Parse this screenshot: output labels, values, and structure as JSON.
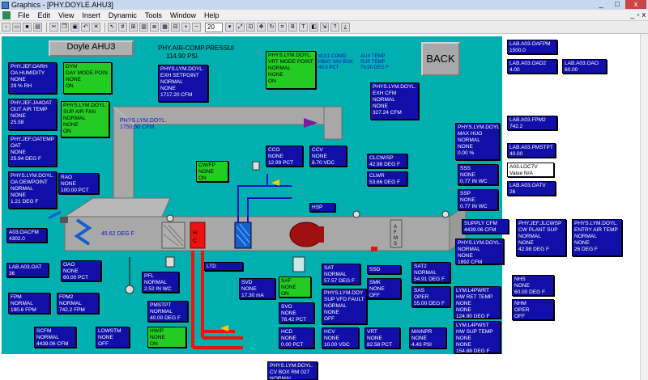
{
  "window": {
    "title": "Graphics - [PHY.DOYLE.AHU3]",
    "min": "_",
    "max": "□",
    "close": "x"
  },
  "menu": [
    "File",
    "Edit",
    "View",
    "Insert",
    "Dynamic",
    "Tools",
    "Window",
    "Help"
  ],
  "mdi": {
    "min": "_",
    "restore": "▫",
    "close": "x"
  },
  "toolbar": {
    "zoom": "20"
  },
  "header": {
    "ahu_title": "Doyle AHU3",
    "back_label": "BACK",
    "air_comp_label": "PHY.AIR-COMP.PRESSUI",
    "air_comp_value": "114.90 PSI"
  },
  "labels": {
    "vlv_comd": "VLV1 COMD\nHBAY VAV BOX\n40.0 PCT",
    "aux_temp": "AUX TEMP\nSUP TEMP\n79.00 DEG F",
    "duct_cfm": "PHYS.LYM.DOYL.\n1750.50 CFM",
    "duct_temp": "45.62 DEG F"
  },
  "boxes": [
    {
      "name": "oa-humidity",
      "text": "PHY.JEF.OARH\nOA HUMIDITY\nNONE\n29 % RH"
    },
    {
      "name": "day-mode-point",
      "text": "DYM\nDAY MODE POIN\nNONE\nON",
      "style": "green"
    },
    {
      "name": "exh-setpoint",
      "text": "PHYS.LYM.DOYL.\nEXH SETPOINT\nNORMAL\nNONE\n1717.20 CFM"
    },
    {
      "name": "vrt-mode-point",
      "text": "PHYS.LYM.DOYL.\nVRT MODE POINT\nNORMAL\nNONE\nON",
      "style": "green"
    },
    {
      "name": "lab-a03-oafpm",
      "text": "LAB.A03.OAFPM\n1500.0"
    },
    {
      "name": "lab-a03-oad2",
      "text": "LAB.A03.OAD2\n4.00"
    },
    {
      "name": "lab-a03-oao",
      "text": "LAB.A03.OAO\n60.00"
    },
    {
      "name": "out-air-temp",
      "text": "PHY.JEF.JA4OAT\nOUT AIR TEMP\nNONE\n25.58"
    },
    {
      "name": "sup-air-fan",
      "text": "PHYS.LYM.DOYL.\nSUP AIR FAN\nNORMAL\nNONE\nON",
      "style": "green"
    },
    {
      "name": "exh-cfm",
      "text": "PHYS.LYM.DOYL.\nEXH CFM\nNORMAL\nNONE\n327.24 CFM"
    },
    {
      "name": "lab-a03-fpm2",
      "text": "LAB.A03.FPM2\n742.2"
    },
    {
      "name": "oat",
      "text": "PHY.JEF.OATEMP\nOAT\nNONE\n25.94 DEG F"
    },
    {
      "name": "max-hvo",
      "text": "PHYS.LYM.DOYL.\nMAX HUO\nNORMAL\nNONE\n0.00 %"
    },
    {
      "name": "lab-a03-pmstpt",
      "text": "LAB.A03.PMSTPT\n40.00"
    },
    {
      "name": "cco",
      "text": "CCO\nNONE\n12.99 PCT"
    },
    {
      "name": "ccv",
      "text": "CCV\nNONE\n8.70 VDC"
    },
    {
      "name": "clcw-sp",
      "text": "CLCW/SP\n42.98 DEG F"
    },
    {
      "name": "a03-loc7v",
      "text": "A03.LOC7V\nValue N/A",
      "style": "light"
    },
    {
      "name": "cw-fp",
      "text": "CW/FP\nNONE\nON",
      "style": "green"
    },
    {
      "name": "sss",
      "text": "SSS\nNONE\n0.77 IN WC"
    },
    {
      "name": "oa-dewpoint",
      "text": "PHYS.LYM.DOYL.\nOA DEWPOINT\nNORMAL\nNONE\n1.21 DEG F"
    },
    {
      "name": "clwr",
      "text": "CLWR\n53.66 DEG F"
    },
    {
      "name": "lab-a03-oatv",
      "text": "LAB.A03.OATV\n26"
    },
    {
      "name": "rao",
      "text": "RAO\nNONE\n100.00 PCT"
    },
    {
      "name": "ssp",
      "text": "SSP\nNONE\n0.77 IN WC"
    },
    {
      "name": "hsp",
      "text": "HSP"
    },
    {
      "name": "supply-cfm",
      "text": "SUPPLY CFM\n4439.06 CFM"
    },
    {
      "name": "cw-plant-sup",
      "text": "PHY.JEF.JLCWSP\nCW PLANT SUP\nNORMAL\nNONE\n42.98 DEG F"
    },
    {
      "name": "entry-air-temp",
      "text": "PHYS.LYM.DOYL.\nENTRY AIR TEMP\nNORMAL\nNONE\n26 DEG F"
    },
    {
      "name": "a03-oacfm",
      "text": "A03.OACFM\n4302.0"
    },
    {
      "name": "doyl-1892-cfm",
      "text": "PHYS.LYM.DOYL.\nNORMAL\nNONE\n1892 CFM"
    },
    {
      "name": "lab-a03-oat",
      "text": "LAB.A03.OAT\n36"
    },
    {
      "name": "ltd",
      "text": "LTD"
    },
    {
      "name": "oao",
      "text": "OAO\nNONE\n60.00 PCT"
    },
    {
      "name": "pfl",
      "text": "PFL\nNORMAL\n2.52 IN WC"
    },
    {
      "name": "sat",
      "text": "SAT\nNORMAL\n57.57 DEG F"
    },
    {
      "name": "ssd",
      "text": "SSD"
    },
    {
      "name": "sat2",
      "text": "SAT2\nNORMAL\n54.91 DEG F"
    },
    {
      "name": "nhs",
      "text": "NHS\nNONE\n60.00 DEG F"
    },
    {
      "name": "svd",
      "text": "SVD\nNONE\n17.30 mA"
    },
    {
      "name": "saf",
      "text": "SAF\nNONE\nON",
      "style": "green"
    },
    {
      "name": "smk",
      "text": "SMK\nNONE\nOFF"
    },
    {
      "name": "sas",
      "text": "SAS\nOPER\n55.00 DEG F"
    },
    {
      "name": "hw-ret-temp",
      "text": "LYM.L4PWRT\nHW RET TEMP\nNONE\nNONE\n124.90 DEG F"
    },
    {
      "name": "nhm",
      "text": "NHM\nOPER\nOFF"
    },
    {
      "name": "fpm",
      "text": "FPM\nNORMAL\n190.6 FPM"
    },
    {
      "name": "fpm2",
      "text": "FPM2\nNORMAL\n742.2 FPM"
    },
    {
      "name": "pmstpt",
      "text": "PMSTPT\nNORMAL\n40.00 DEG F"
    },
    {
      "name": "sup-vfd-fault",
      "text": "PHYS.LYM.DOY\nSUP VFD FAULT\nNORMAL\nNONE\nOFF"
    },
    {
      "name": "svo",
      "text": "SVO\nNONE\n78.42 PCT"
    },
    {
      "name": "hw-sup-temp",
      "text": "LYM.L4PWST\nHW SUP TEMP\nNONE\nNONE\n154.88 DEG F"
    },
    {
      "name": "scfm",
      "text": "SCFM\nNORMAL\n4439.06 CFM"
    },
    {
      "name": "lowstm",
      "text": "LOWSTM\nNONE\nOFF"
    },
    {
      "name": "hw-p",
      "text": "HW/P\nNONE\nON",
      "style": "green"
    },
    {
      "name": "hcd",
      "text": "HCD\nNONE\n0.00 PCT"
    },
    {
      "name": "hcv",
      "text": "HCV\nNONE\n10.00 VDC"
    },
    {
      "name": "vrt",
      "text": "VRT\nNONE\n82.58 PCT"
    },
    {
      "name": "mainpr",
      "text": "MAINPR\nNONE\n4.43 PSI"
    },
    {
      "name": "cv-box-rm027",
      "text": "PHYS.LYM.DOYL.\nCV BOX RM 027\nNORMAL"
    }
  ],
  "colors": {
    "panel": "#00b0b0",
    "duct": "#a8a8a8",
    "box": "#1010a8",
    "green": "#22cc22",
    "hw_pipe": "#ee1111",
    "cw_pipe": "#1010c8"
  }
}
